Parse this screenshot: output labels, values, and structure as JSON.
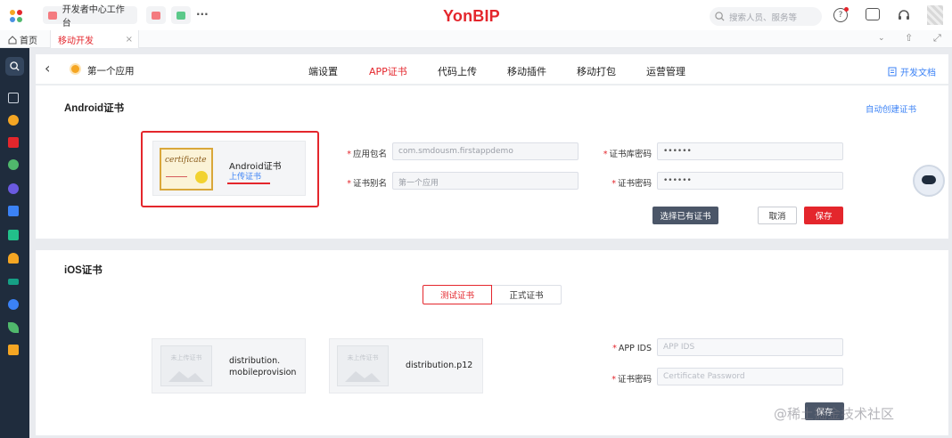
{
  "topbar": {
    "tab_label": "开发者中心工作台",
    "more_dots": "···",
    "logo": "YonBIP",
    "search_placeholder": "搜索人员、服务等",
    "colors": {
      "brand": "#e4262c",
      "sidebar": "#1f2c3d"
    }
  },
  "tabbar": {
    "home_label": "首页",
    "active_tab": "移动开发",
    "close_glyph": "×"
  },
  "subheader": {
    "back_glyph": "‹",
    "app_name": "第一个应用",
    "tabs": [
      "端设置",
      "APP证书",
      "代码上传",
      "移动插件",
      "移动打包",
      "运营管理"
    ],
    "active_tab_index": 1,
    "doc_link": "开发文档"
  },
  "android": {
    "section_title": "Android证书",
    "auto_create_link": "自动创建证书",
    "cert_image_text": "certificate",
    "cert_title": "Android证书",
    "cert_upload_link": "上传证书",
    "fields": {
      "package_label": "应用包名",
      "package_value": "com.smdousm.firstappdemo",
      "alias_label": "证书别名",
      "alias_value": "第一个应用",
      "store_password_label": "证书库密码",
      "store_password_value": "••••••",
      "cert_password_label": "证书密码",
      "cert_password_value": "••••••"
    },
    "buttons": {
      "choose_existing": "选择已有证书",
      "cancel": "取消",
      "save": "保存"
    }
  },
  "ios": {
    "section_title": "iOS证书",
    "tabs": [
      "测试证书",
      "正式证书"
    ],
    "active_tab_index": 0,
    "placeholder_text": "未上传证书",
    "file1_name_line1": "distribution.",
    "file1_name_line2": "mobileprovision",
    "file2_name": "distribution.p12",
    "app_ids_label": "APP IDS",
    "app_ids_placeholder": "APP IDS",
    "cert_password_label": "证书密码",
    "cert_password_placeholder": "Certificate Password",
    "save_label": "保存"
  },
  "watermark": "@稀土掘金技术社区"
}
